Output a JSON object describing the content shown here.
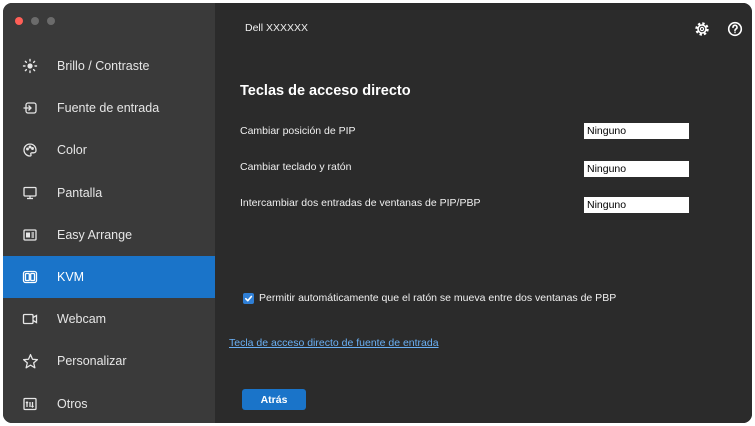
{
  "window": {
    "traffic_lights": [
      "#ff5f57",
      "#6b6b6b",
      "#6b6b6b"
    ]
  },
  "header": {
    "title": "Dell XXXXXX",
    "icons": [
      "gear-icon",
      "help-icon"
    ]
  },
  "sidebar": {
    "items": [
      {
        "label": "Brillo / Contraste",
        "icon": "brightness-icon",
        "active": false
      },
      {
        "label": "Fuente de entrada",
        "icon": "input-source-icon",
        "active": false
      },
      {
        "label": "Color",
        "icon": "palette-icon",
        "active": false
      },
      {
        "label": "Pantalla",
        "icon": "monitor-icon",
        "active": false
      },
      {
        "label": "Easy Arrange",
        "icon": "layout-icon",
        "active": false
      },
      {
        "label": "KVM",
        "icon": "kvm-icon",
        "active": true
      },
      {
        "label": "Webcam",
        "icon": "webcam-icon",
        "active": false
      },
      {
        "label": "Personalizar",
        "icon": "star-icon",
        "active": false
      },
      {
        "label": "Otros",
        "icon": "others-icon",
        "active": false
      }
    ]
  },
  "main": {
    "heading": "Teclas de acceso directo",
    "hotkeys": [
      {
        "label": "Cambiar posición de PIP",
        "value": "Ninguno"
      },
      {
        "label": "Cambiar teclado y ratón",
        "value": "Ninguno"
      },
      {
        "label": "Intercambiar dos entradas de ventanas de PIP/PBP",
        "value": "Ninguno"
      }
    ],
    "checkbox_label": "Permitir automáticamente que el ratón se mueva entre dos ventanas de PBP",
    "checkbox_checked": true,
    "link_text": "Tecla de acceso directo de fuente de entrada",
    "back_label": "Atrás"
  },
  "colors": {
    "accent": "#1a74c9",
    "sidebar_bg": "#3a3a3a",
    "main_bg": "#2b2b2b",
    "link": "#6ab0f5"
  }
}
